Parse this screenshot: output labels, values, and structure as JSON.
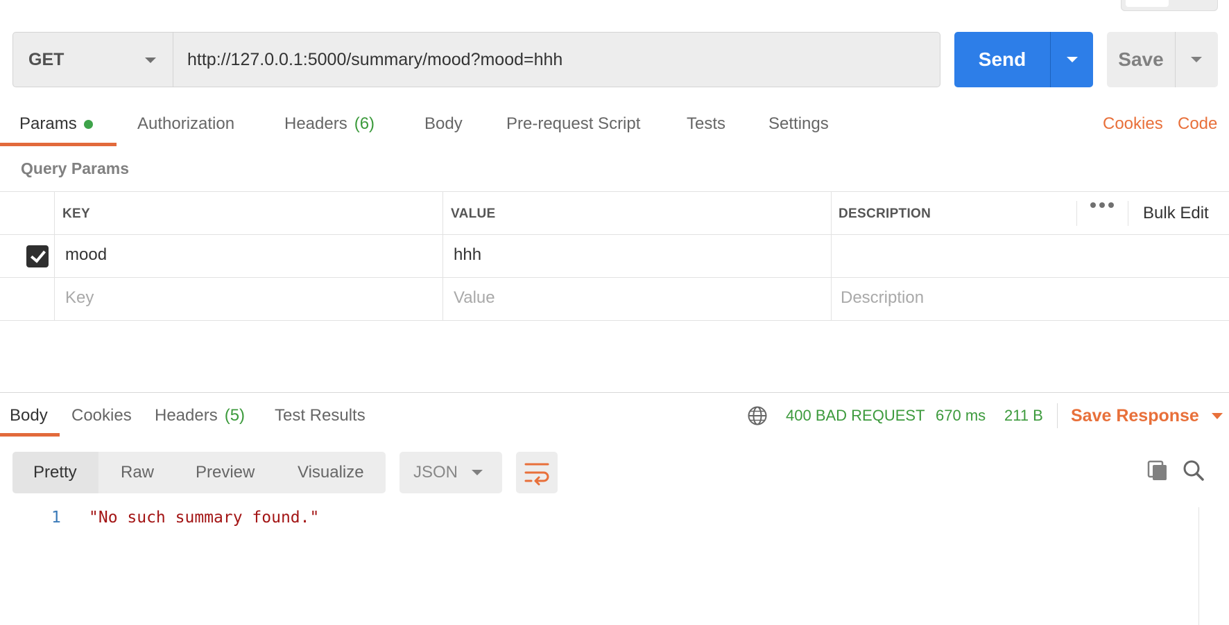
{
  "request": {
    "method": "GET",
    "url": "http://127.0.0.1:5000/summary/mood?mood=hhh",
    "send_label": "Send",
    "save_label": "Save"
  },
  "request_tabs": {
    "params": "Params",
    "authorization": "Authorization",
    "headers": "Headers",
    "headers_count": "(6)",
    "body": "Body",
    "prerequest": "Pre-request Script",
    "tests": "Tests",
    "settings": "Settings",
    "cookies": "Cookies",
    "code": "Code"
  },
  "query_params": {
    "title": "Query Params",
    "columns": {
      "key": "KEY",
      "value": "VALUE",
      "description": "DESCRIPTION"
    },
    "bulk_edit": "Bulk Edit",
    "rows": [
      {
        "key": "mood",
        "value": "hhh",
        "description": "",
        "checked": true
      }
    ],
    "placeholders": {
      "key": "Key",
      "value": "Value",
      "description": "Description"
    }
  },
  "response_tabs": {
    "body": "Body",
    "cookies": "Cookies",
    "headers": "Headers",
    "headers_count": "(5)",
    "test_results": "Test Results"
  },
  "response_status": {
    "status": "400 BAD REQUEST",
    "time": "670 ms",
    "size": "211 B",
    "save_response": "Save Response"
  },
  "format_bar": {
    "pretty": "Pretty",
    "raw": "Raw",
    "preview": "Preview",
    "visualize": "Visualize",
    "language": "JSON"
  },
  "response_body": {
    "line_number": "1",
    "line_text": "\"No such summary found.\""
  },
  "colors": {
    "accent_blue": "#2d7ee8",
    "accent_orange": "#e8703a",
    "success_green": "#3c9a3c"
  },
  "icons": {
    "globe": "globe-icon",
    "copy": "copy-icon",
    "search": "search-icon",
    "wrap": "wrap-lines-icon",
    "more": "more-horizontal-icon"
  }
}
